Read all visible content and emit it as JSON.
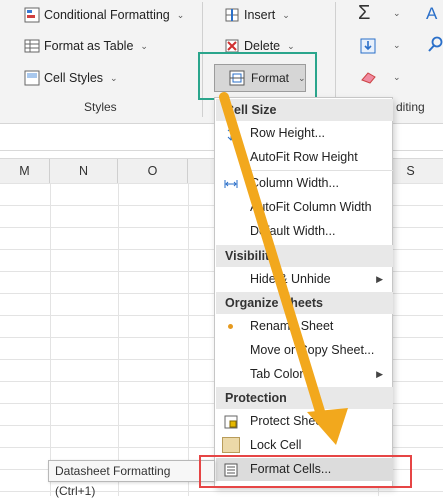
{
  "ribbon": {
    "conditional_formatting": "Conditional Formatting",
    "format_as_table": "Format as Table",
    "cell_styles": "Cell Styles",
    "styles_group": "Styles",
    "insert": "Insert",
    "delete": "Delete",
    "format": "Format",
    "editing_group": "diting"
  },
  "columns": [
    "M",
    "N",
    "O",
    "S"
  ],
  "menu": {
    "cell_size": "Cell Size",
    "row_height": "Row Height...",
    "autofit_row": "AutoFit Row Height",
    "column_width": "Column Width...",
    "autofit_column": "AutoFit Column Width",
    "default_width": "Default Width...",
    "visibility": "Visibility",
    "hide_unhide": "Hide & Unhide",
    "organize_sheets": "Organize Sheets",
    "rename_sheet": "Rename Sheet",
    "move_copy": "Move or Copy Sheet...",
    "tab_color": "Tab Color",
    "protection": "Protection",
    "protect_sheet": "Protect Sheet...",
    "lock_cell": "Lock Cell",
    "format_cells": "Format Cells..."
  },
  "tooltip": "Datasheet Formatting (Ctrl+1)",
  "colors": {
    "highlight_teal": "#2aa58c",
    "highlight_red": "#e64545",
    "arrow_orange": "#f2a81d"
  }
}
